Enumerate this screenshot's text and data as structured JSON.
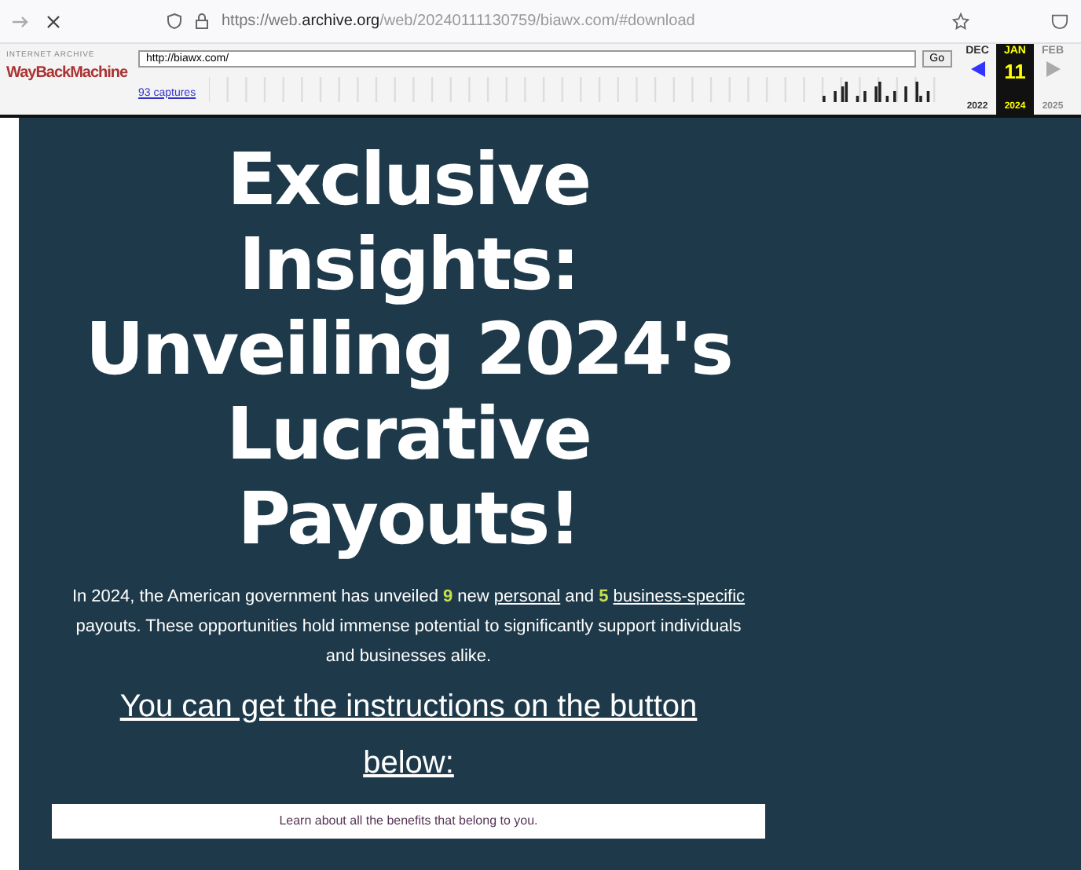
{
  "browser": {
    "url_host": "https://web.archive.org",
    "url_path": "/web/20240111130759/biawx.com/#download"
  },
  "wayback": {
    "logo_top": "INTERNET ARCHIVE",
    "logo": "WayBackMachine",
    "url": "http://biawx.com/",
    "go": "Go",
    "captures": "93 captures",
    "months": [
      {
        "label": "DEC",
        "selected": false
      },
      {
        "label": "JAN",
        "selected": true
      },
      {
        "label": "FEB",
        "selected": false
      }
    ],
    "day": "11",
    "years": [
      {
        "label": "2022",
        "selected": false
      },
      {
        "label": "2024",
        "selected": true
      },
      {
        "label": "2025",
        "selected": false
      }
    ]
  },
  "page": {
    "heading": "Exclusive Insights: Unveiling 2024's Lucrative Payouts!",
    "paragraph": [
      {
        "kind": "text",
        "text": "In 2024, the American government has unveiled "
      },
      {
        "kind": "number",
        "text": "9"
      },
      {
        "kind": "text",
        "text": " new "
      },
      {
        "kind": "link",
        "text": "personal"
      },
      {
        "kind": "text",
        "text": " and "
      },
      {
        "kind": "number",
        "text": "5"
      },
      {
        "kind": "link",
        "text": "business-specific",
        "space_before": true
      },
      {
        "kind": "text",
        "text": " payouts. These opportunities hold immense potential to significantly support individuals and businesses alike."
      }
    ],
    "subheading": "You can get the instructions on the button below:",
    "button": "Learn about all the benefits that belong to you."
  }
}
